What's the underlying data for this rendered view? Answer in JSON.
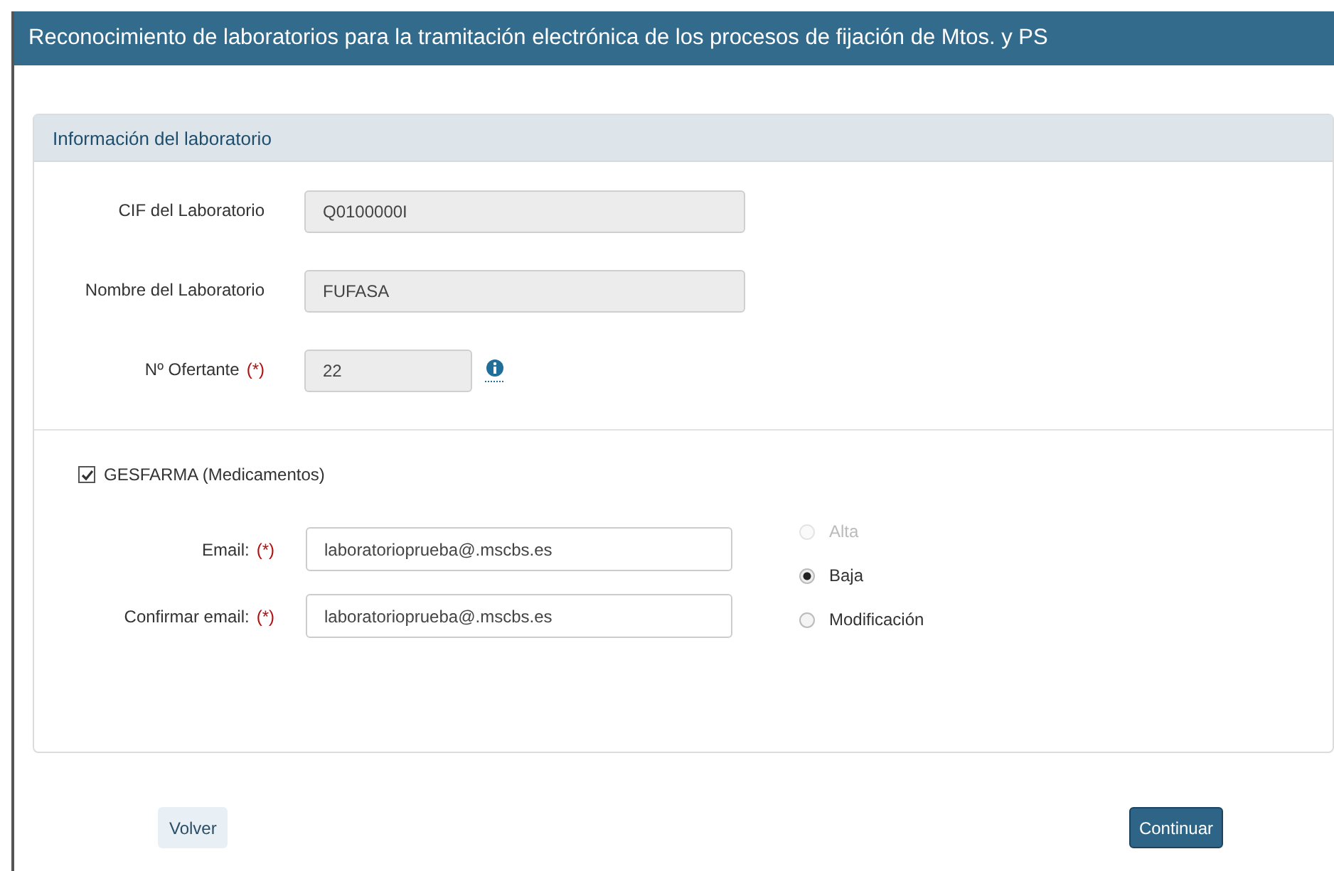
{
  "window": {
    "title": "Reconocimiento de laboratorios para la tramitación electrónica de los procesos de fijación de Mtos. y PS"
  },
  "panel": {
    "title": "Información del laboratorio",
    "fields": [
      {
        "label": "CIF del Laboratorio",
        "required": false,
        "value": "Q0100000I",
        "kind": "wide",
        "info": false
      },
      {
        "label": "Nombre del Laboratorio",
        "required": false,
        "value": "FUFASA",
        "kind": "wide",
        "info": false
      },
      {
        "label": "Nº Ofertante",
        "required": true,
        "value": "22",
        "kind": "short",
        "info": true
      }
    ],
    "required_mark": "(*)",
    "system": {
      "label": "GESFARMA (Medicamentos)",
      "checked": true
    },
    "emails": [
      {
        "label": "Email:",
        "required": true,
        "value": "laboratorioprueba@.mscbs.es"
      },
      {
        "label": "Confirmar email:",
        "required": true,
        "value": "laboratorioprueba@.mscbs.es"
      }
    ],
    "options": [
      {
        "label": "Alta",
        "selected": false,
        "disabled": true
      },
      {
        "label": "Baja",
        "selected": true,
        "disabled": false
      },
      {
        "label": "Modificación",
        "selected": false,
        "disabled": false
      }
    ]
  },
  "buttons": [
    {
      "label": "Volver",
      "kind": "secondary"
    },
    {
      "label": "Continuar",
      "kind": "primary"
    }
  ]
}
